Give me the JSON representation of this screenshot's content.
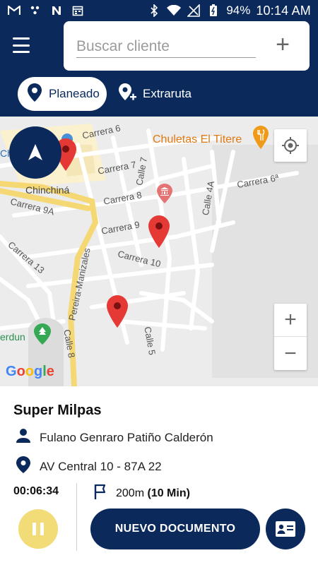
{
  "status_bar": {
    "battery": "94%",
    "time": "10:14 AM"
  },
  "search": {
    "placeholder": "Buscar cliente",
    "add_label": "+"
  },
  "tabs": [
    {
      "label": "Planeado",
      "selected": true
    },
    {
      "label": "Extraruta",
      "selected": false
    }
  ],
  "map": {
    "labels": {
      "carrera6": "Carrera 6",
      "carrera7": "Carrera 7",
      "carrera8": "Carrera 8",
      "carrera9": "Carrera 9",
      "carrera9a": "Carrera 9A",
      "carrera10": "Carrera 10",
      "carrera13": "Carrera 13",
      "carrera6a": "Carrera 6ª",
      "calle4a": "Calle 4A",
      "calle5": "Calle 5",
      "calle7": "Calle 7",
      "calle8": "Calle 8",
      "pereira": "Pereira-Manizales",
      "chinchina": "Chinchiná",
      "erdun": "erdun",
      "ch": "Ch"
    },
    "poi": "Chuletas El Titere",
    "google": "Google",
    "zoom_in": "+",
    "zoom_out": "−"
  },
  "client": {
    "name": "Super Milpas",
    "contact": "Fulano Genraro Patiño Calderón",
    "address": "AV Central 10 - 87A 22"
  },
  "visit": {
    "timer": "00:06:34",
    "distance": "200m",
    "duration": "(10 Min)"
  },
  "actions": {
    "new_document": "NUEVO DOCUMENTO"
  },
  "colors": {
    "primary": "#0b2a5b",
    "pause": "#f1dc78",
    "pin": "#e53935",
    "poi": "#e07a12"
  }
}
